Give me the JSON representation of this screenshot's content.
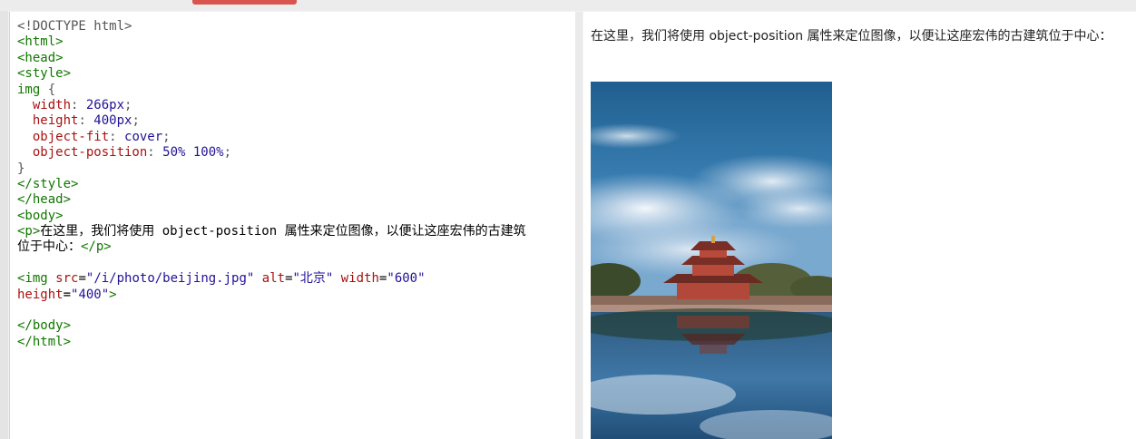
{
  "code_lines": [
    [
      [
        "doc",
        "<!DOCTYPE html>"
      ]
    ],
    [
      [
        "tag",
        "<html>"
      ]
    ],
    [
      [
        "tag",
        "<head>"
      ]
    ],
    [
      [
        "tag",
        "<style>"
      ]
    ],
    [
      [
        "tag",
        "img "
      ],
      [
        "br",
        "{"
      ]
    ],
    [
      [
        "text",
        "  "
      ],
      [
        "prop",
        "width"
      ],
      [
        "br",
        ": "
      ],
      [
        "val",
        "266px"
      ],
      [
        "br",
        ";"
      ]
    ],
    [
      [
        "text",
        "  "
      ],
      [
        "prop",
        "height"
      ],
      [
        "br",
        ": "
      ],
      [
        "val",
        "400px"
      ],
      [
        "br",
        ";"
      ]
    ],
    [
      [
        "text",
        "  "
      ],
      [
        "prop",
        "object-fit"
      ],
      [
        "br",
        ": "
      ],
      [
        "val",
        "cover"
      ],
      [
        "br",
        ";"
      ]
    ],
    [
      [
        "text",
        "  "
      ],
      [
        "prop",
        "object-position"
      ],
      [
        "br",
        ": "
      ],
      [
        "val",
        "50% 100%"
      ],
      [
        "br",
        ";"
      ]
    ],
    [
      [
        "br",
        "}"
      ]
    ],
    [
      [
        "tag",
        "</style>"
      ]
    ],
    [
      [
        "tag",
        "</head>"
      ]
    ],
    [
      [
        "tag",
        "<body>"
      ]
    ],
    [
      [
        "tag",
        "<p>"
      ],
      [
        "text",
        "在这里，我们将使用 object-position 属性来定位图像，以便让这座宏伟的古建筑"
      ]
    ],
    [
      [
        "text",
        "位于中心："
      ],
      [
        "tag",
        "</p>"
      ]
    ],
    [
      [
        "text",
        ""
      ]
    ],
    [
      [
        "tag",
        "<img "
      ],
      [
        "attr",
        "src"
      ],
      [
        "text",
        "="
      ],
      [
        "str",
        "\"/i/photo/beijing.jpg\""
      ],
      [
        "text",
        " "
      ],
      [
        "attr",
        "alt"
      ],
      [
        "text",
        "="
      ],
      [
        "str",
        "\"北京\""
      ],
      [
        "text",
        " "
      ],
      [
        "attr",
        "width"
      ],
      [
        "text",
        "="
      ],
      [
        "str",
        "\"600\""
      ]
    ],
    [
      [
        "attr",
        "height"
      ],
      [
        "text",
        "="
      ],
      [
        "str",
        "\"400\""
      ],
      [
        "tag",
        ">"
      ]
    ],
    [
      [
        "text",
        ""
      ]
    ],
    [
      [
        "tag",
        "</body>"
      ]
    ],
    [
      [
        "tag",
        "</html>"
      ]
    ]
  ],
  "result": {
    "paragraph": "在这里，我们将使用 object-position 属性来定位图像，以便让这座宏伟的古建筑位于中心：",
    "image_alt": "北京"
  }
}
